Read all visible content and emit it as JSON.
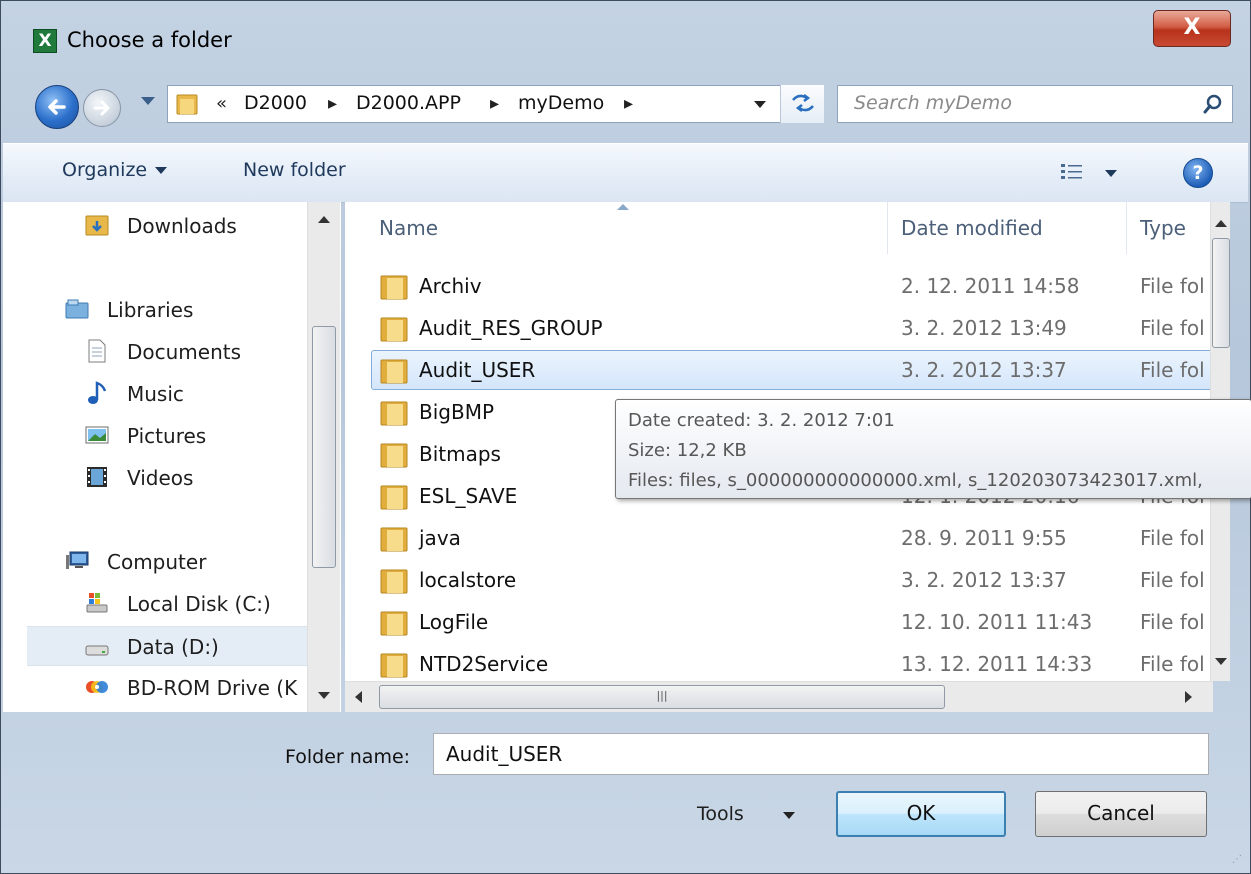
{
  "window": {
    "title": "Choose a folder",
    "close_label": "X"
  },
  "address": {
    "overflow": "«",
    "crumbs": [
      "D2000",
      "D2000.APP",
      "myDemo"
    ],
    "separator": "▸"
  },
  "search": {
    "placeholder": "Search myDemo"
  },
  "toolbar": {
    "organize": "Organize",
    "new_folder": "New folder",
    "help": "?"
  },
  "nav": {
    "items": [
      {
        "label": "Downloads",
        "icon": "downloads-folder-icon"
      },
      {
        "label": "Libraries",
        "icon": "libraries-icon"
      },
      {
        "label": "Documents",
        "icon": "documents-icon"
      },
      {
        "label": "Music",
        "icon": "music-icon"
      },
      {
        "label": "Pictures",
        "icon": "pictures-icon"
      },
      {
        "label": "Videos",
        "icon": "videos-icon"
      },
      {
        "label": "Computer",
        "icon": "computer-icon"
      },
      {
        "label": "Local Disk (C:)",
        "icon": "local-disk-icon"
      },
      {
        "label": "Data (D:)",
        "icon": "drive-icon"
      },
      {
        "label": "BD-ROM Drive (K",
        "icon": "bd-rom-icon"
      }
    ],
    "selected": "Data (D:)"
  },
  "list": {
    "columns": {
      "name": "Name",
      "date": "Date modified",
      "type": "Type"
    },
    "sort_column": "Name",
    "rows": [
      {
        "name": "Archiv",
        "date": "2. 12. 2011 14:58",
        "type": "File fol"
      },
      {
        "name": "Audit_RES_GROUP",
        "date": "3. 2. 2012 13:49",
        "type": "File fol"
      },
      {
        "name": "Audit_USER",
        "date": "3. 2. 2012 13:37",
        "type": "File fol"
      },
      {
        "name": "BigBMP",
        "date": "",
        "type": ""
      },
      {
        "name": "Bitmaps",
        "date": "",
        "type": ""
      },
      {
        "name": "ESL_SAVE",
        "date": "12. 1. 2012 20:16",
        "type": "File fol"
      },
      {
        "name": "java",
        "date": "28. 9. 2011 9:55",
        "type": "File fol"
      },
      {
        "name": "localstore",
        "date": "3. 2. 2012 13:37",
        "type": "File fol"
      },
      {
        "name": "LogFile",
        "date": "12. 10. 2011 11:43",
        "type": "File fol"
      },
      {
        "name": "NTD2Service",
        "date": "13. 12. 2011 14:33",
        "type": "File fol"
      }
    ],
    "selected_row": "Audit_USER"
  },
  "tooltip": {
    "created": "Date created: 3. 2. 2012 7:01",
    "size": "Size: 12,2 KB",
    "files": "Files: files, s_000000000000000.xml, s_120203073423017.xml,"
  },
  "footer": {
    "folder_name_label": "Folder name:",
    "folder_name_value": "Audit_USER",
    "tools_label": "Tools",
    "ok_label": "OK",
    "cancel_label": "Cancel"
  }
}
